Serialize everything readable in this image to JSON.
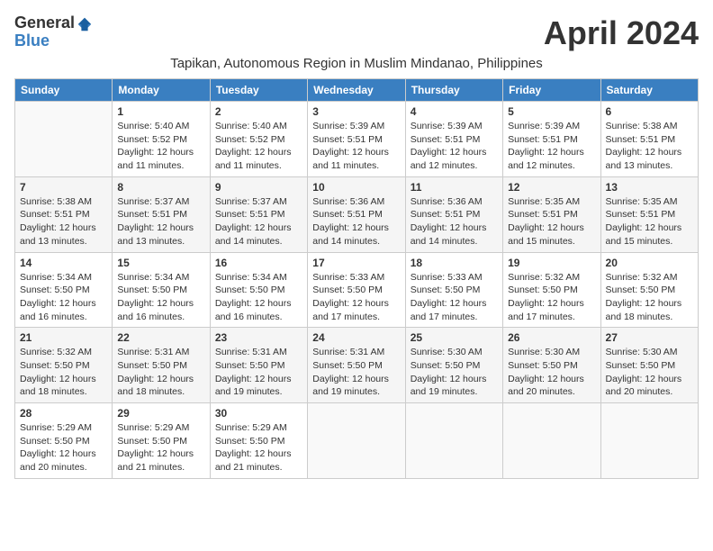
{
  "header": {
    "logo_general": "General",
    "logo_blue": "Blue",
    "month_title": "April 2024",
    "subtitle": "Tapikan, Autonomous Region in Muslim Mindanao, Philippines"
  },
  "days_of_week": [
    "Sunday",
    "Monday",
    "Tuesday",
    "Wednesday",
    "Thursday",
    "Friday",
    "Saturday"
  ],
  "weeks": [
    [
      {
        "day": "",
        "sunrise": "",
        "sunset": "",
        "daylight": ""
      },
      {
        "day": "1",
        "sunrise": "Sunrise: 5:40 AM",
        "sunset": "Sunset: 5:52 PM",
        "daylight": "Daylight: 12 hours and 11 minutes."
      },
      {
        "day": "2",
        "sunrise": "Sunrise: 5:40 AM",
        "sunset": "Sunset: 5:52 PM",
        "daylight": "Daylight: 12 hours and 11 minutes."
      },
      {
        "day": "3",
        "sunrise": "Sunrise: 5:39 AM",
        "sunset": "Sunset: 5:51 PM",
        "daylight": "Daylight: 12 hours and 11 minutes."
      },
      {
        "day": "4",
        "sunrise": "Sunrise: 5:39 AM",
        "sunset": "Sunset: 5:51 PM",
        "daylight": "Daylight: 12 hours and 12 minutes."
      },
      {
        "day": "5",
        "sunrise": "Sunrise: 5:39 AM",
        "sunset": "Sunset: 5:51 PM",
        "daylight": "Daylight: 12 hours and 12 minutes."
      },
      {
        "day": "6",
        "sunrise": "Sunrise: 5:38 AM",
        "sunset": "Sunset: 5:51 PM",
        "daylight": "Daylight: 12 hours and 13 minutes."
      }
    ],
    [
      {
        "day": "7",
        "sunrise": "Sunrise: 5:38 AM",
        "sunset": "Sunset: 5:51 PM",
        "daylight": "Daylight: 12 hours and 13 minutes."
      },
      {
        "day": "8",
        "sunrise": "Sunrise: 5:37 AM",
        "sunset": "Sunset: 5:51 PM",
        "daylight": "Daylight: 12 hours and 13 minutes."
      },
      {
        "day": "9",
        "sunrise": "Sunrise: 5:37 AM",
        "sunset": "Sunset: 5:51 PM",
        "daylight": "Daylight: 12 hours and 14 minutes."
      },
      {
        "day": "10",
        "sunrise": "Sunrise: 5:36 AM",
        "sunset": "Sunset: 5:51 PM",
        "daylight": "Daylight: 12 hours and 14 minutes."
      },
      {
        "day": "11",
        "sunrise": "Sunrise: 5:36 AM",
        "sunset": "Sunset: 5:51 PM",
        "daylight": "Daylight: 12 hours and 14 minutes."
      },
      {
        "day": "12",
        "sunrise": "Sunrise: 5:35 AM",
        "sunset": "Sunset: 5:51 PM",
        "daylight": "Daylight: 12 hours and 15 minutes."
      },
      {
        "day": "13",
        "sunrise": "Sunrise: 5:35 AM",
        "sunset": "Sunset: 5:51 PM",
        "daylight": "Daylight: 12 hours and 15 minutes."
      }
    ],
    [
      {
        "day": "14",
        "sunrise": "Sunrise: 5:34 AM",
        "sunset": "Sunset: 5:50 PM",
        "daylight": "Daylight: 12 hours and 16 minutes."
      },
      {
        "day": "15",
        "sunrise": "Sunrise: 5:34 AM",
        "sunset": "Sunset: 5:50 PM",
        "daylight": "Daylight: 12 hours and 16 minutes."
      },
      {
        "day": "16",
        "sunrise": "Sunrise: 5:34 AM",
        "sunset": "Sunset: 5:50 PM",
        "daylight": "Daylight: 12 hours and 16 minutes."
      },
      {
        "day": "17",
        "sunrise": "Sunrise: 5:33 AM",
        "sunset": "Sunset: 5:50 PM",
        "daylight": "Daylight: 12 hours and 17 minutes."
      },
      {
        "day": "18",
        "sunrise": "Sunrise: 5:33 AM",
        "sunset": "Sunset: 5:50 PM",
        "daylight": "Daylight: 12 hours and 17 minutes."
      },
      {
        "day": "19",
        "sunrise": "Sunrise: 5:32 AM",
        "sunset": "Sunset: 5:50 PM",
        "daylight": "Daylight: 12 hours and 17 minutes."
      },
      {
        "day": "20",
        "sunrise": "Sunrise: 5:32 AM",
        "sunset": "Sunset: 5:50 PM",
        "daylight": "Daylight: 12 hours and 18 minutes."
      }
    ],
    [
      {
        "day": "21",
        "sunrise": "Sunrise: 5:32 AM",
        "sunset": "Sunset: 5:50 PM",
        "daylight": "Daylight: 12 hours and 18 minutes."
      },
      {
        "day": "22",
        "sunrise": "Sunrise: 5:31 AM",
        "sunset": "Sunset: 5:50 PM",
        "daylight": "Daylight: 12 hours and 18 minutes."
      },
      {
        "day": "23",
        "sunrise": "Sunrise: 5:31 AM",
        "sunset": "Sunset: 5:50 PM",
        "daylight": "Daylight: 12 hours and 19 minutes."
      },
      {
        "day": "24",
        "sunrise": "Sunrise: 5:31 AM",
        "sunset": "Sunset: 5:50 PM",
        "daylight": "Daylight: 12 hours and 19 minutes."
      },
      {
        "day": "25",
        "sunrise": "Sunrise: 5:30 AM",
        "sunset": "Sunset: 5:50 PM",
        "daylight": "Daylight: 12 hours and 19 minutes."
      },
      {
        "day": "26",
        "sunrise": "Sunrise: 5:30 AM",
        "sunset": "Sunset: 5:50 PM",
        "daylight": "Daylight: 12 hours and 20 minutes."
      },
      {
        "day": "27",
        "sunrise": "Sunrise: 5:30 AM",
        "sunset": "Sunset: 5:50 PM",
        "daylight": "Daylight: 12 hours and 20 minutes."
      }
    ],
    [
      {
        "day": "28",
        "sunrise": "Sunrise: 5:29 AM",
        "sunset": "Sunset: 5:50 PM",
        "daylight": "Daylight: 12 hours and 20 minutes."
      },
      {
        "day": "29",
        "sunrise": "Sunrise: 5:29 AM",
        "sunset": "Sunset: 5:50 PM",
        "daylight": "Daylight: 12 hours and 21 minutes."
      },
      {
        "day": "30",
        "sunrise": "Sunrise: 5:29 AM",
        "sunset": "Sunset: 5:50 PM",
        "daylight": "Daylight: 12 hours and 21 minutes."
      },
      {
        "day": "",
        "sunrise": "",
        "sunset": "",
        "daylight": ""
      },
      {
        "day": "",
        "sunrise": "",
        "sunset": "",
        "daylight": ""
      },
      {
        "day": "",
        "sunrise": "",
        "sunset": "",
        "daylight": ""
      },
      {
        "day": "",
        "sunrise": "",
        "sunset": "",
        "daylight": ""
      }
    ]
  ]
}
